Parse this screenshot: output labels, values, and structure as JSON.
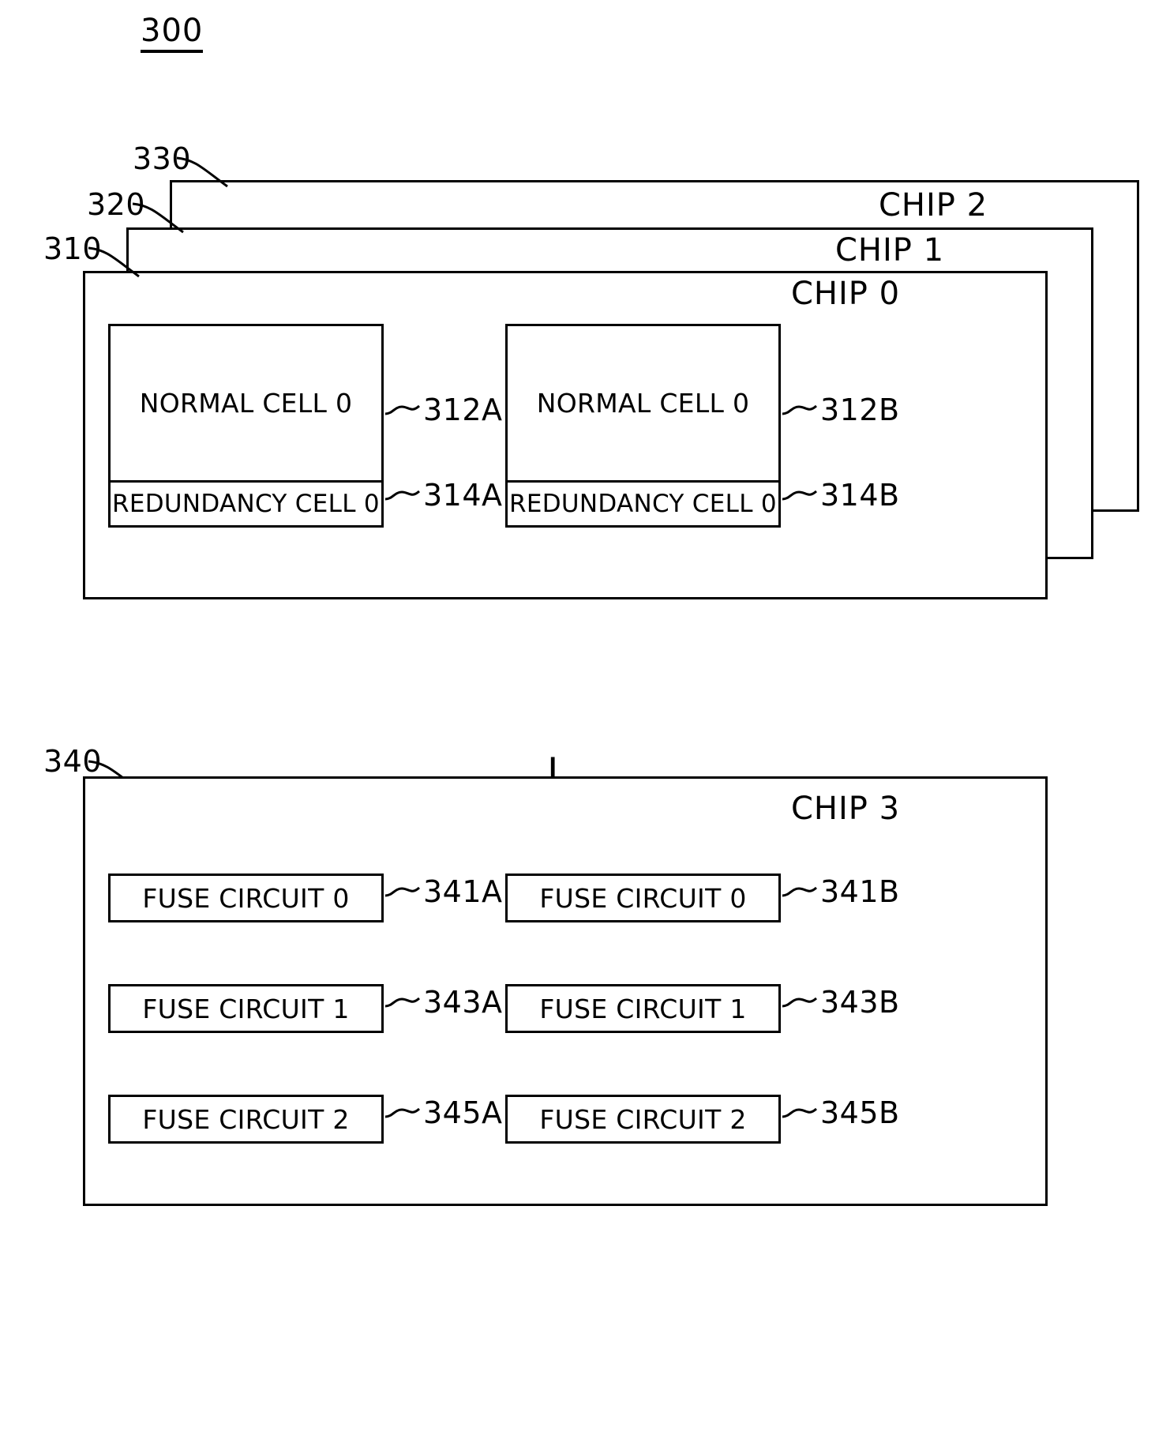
{
  "figure": {
    "number": "300"
  },
  "chip_stack": {
    "refs": {
      "chip2": "330",
      "chip1": "320",
      "chip0": "310"
    },
    "labels": {
      "chip2": "CHIP 2",
      "chip1": "CHIP 1",
      "chip0": "CHIP 0"
    },
    "cell_groups": [
      {
        "normal_cell": "NORMAL CELL 0",
        "normal_cell_ref": "312A",
        "redundancy_cell": "REDUNDANCY CELL 0",
        "redundancy_cell_ref": "314A"
      },
      {
        "normal_cell": "NORMAL CELL 0",
        "normal_cell_ref": "312B",
        "redundancy_cell": "REDUNDANCY CELL 0",
        "redundancy_cell_ref": "314B"
      }
    ]
  },
  "operator": {
    "symbol": "+"
  },
  "fuse_chip": {
    "ref": "340",
    "label": "CHIP 3",
    "columns": [
      {
        "rows": [
          {
            "label": "FUSE CIRCUIT 0",
            "ref": "341A"
          },
          {
            "label": "FUSE CIRCUIT 1",
            "ref": "343A"
          },
          {
            "label": "FUSE CIRCUIT 2",
            "ref": "345A"
          }
        ]
      },
      {
        "rows": [
          {
            "label": "FUSE CIRCUIT 0",
            "ref": "341B"
          },
          {
            "label": "FUSE CIRCUIT 1",
            "ref": "343B"
          },
          {
            "label": "FUSE CIRCUIT 2",
            "ref": "345B"
          }
        ]
      }
    ]
  },
  "colors": {
    "line": "#000000",
    "background": "#ffffff"
  }
}
